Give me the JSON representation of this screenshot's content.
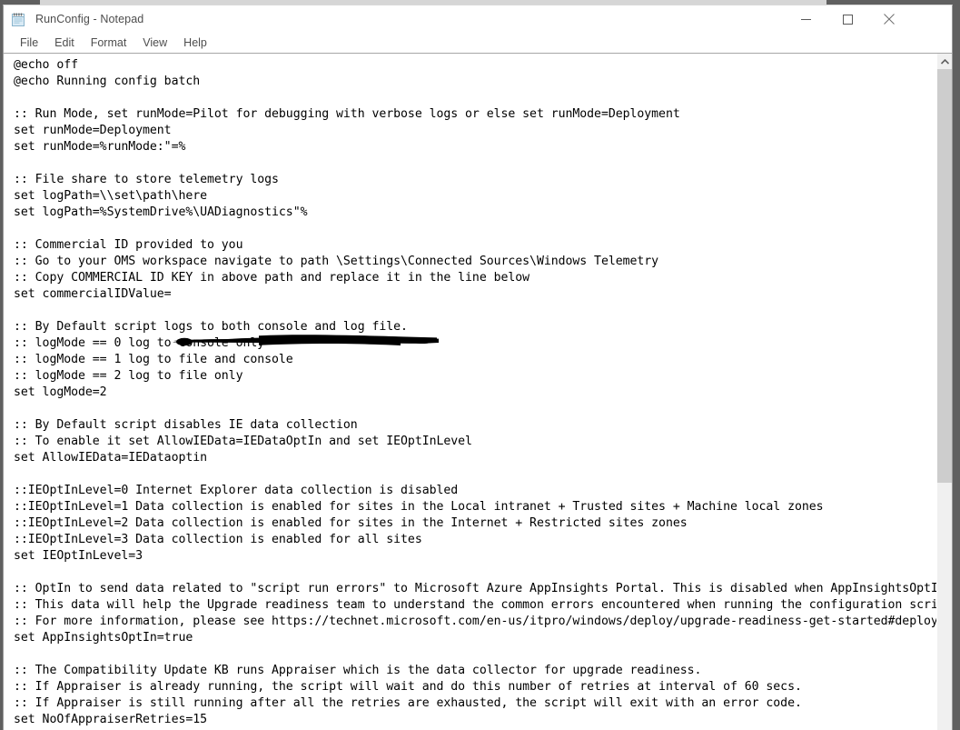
{
  "window": {
    "title": "RunConfig - Notepad",
    "icon": "notepad-icon",
    "controls": {
      "minimize": "minimize-icon",
      "maximize": "maximize-icon",
      "close": "close-icon"
    }
  },
  "menubar": {
    "items": [
      {
        "label": "File"
      },
      {
        "label": "Edit"
      },
      {
        "label": "Format"
      },
      {
        "label": "View"
      },
      {
        "label": "Help"
      }
    ]
  },
  "editor": {
    "content": "@echo off\n@echo Running config batch\n\n:: Run Mode, set runMode=Pilot for debugging with verbose logs or else set runMode=Deployment\nset runMode=Deployment\nset runMode=%runMode:\"=%\n\n:: File share to store telemetry logs\nset logPath=\\\\set\\path\\here\nset logPath=%SystemDrive%\\UADiagnostics\"%\n\n:: Commercial ID provided to you\n:: Go to your OMS workspace navigate to path \\Settings\\Connected Sources\\Windows Telemetry\n:: Copy COMMERCIAL ID KEY in above path and replace it in the line below\nset commercialIDValue=\n\n:: By Default script logs to both console and log file.\n:: logMode == 0 log to console only\n:: logMode == 1 log to file and console\n:: logMode == 2 log to file only\nset logMode=2\n\n:: By Default script disables IE data collection\n:: To enable it set AllowIEData=IEDataOptIn and set IEOptInLevel\nset AllowIEData=IEDataoptin\n\n::IEOptInLevel=0 Internet Explorer data collection is disabled\n::IEOptInLevel=1 Data collection is enabled for sites in the Local intranet + Trusted sites + Machine local zones\n::IEOptInLevel=2 Data collection is enabled for sites in the Internet + Restricted sites zones\n::IEOptInLevel=3 Data collection is enabled for all sites\nset IEOptInLevel=3\n\n:: OptIn to send data related to \"script run errors\" to Microsoft Azure AppInsights Portal. This is disabled when AppInsightsOptIn=false\n:: This data will help the Upgrade readiness team to understand the common errors encountered when running the configuration script\n:: For more information, please see https://technet.microsoft.com/en-us/itpro/windows/deploy/upgrade-readiness-get-started#deployment\nset AppInsightsOptIn=true\n\n:: The Compatibility Update KB runs Appraiser which is the data collector for upgrade readiness.\n:: If Appraiser is already running, the script will wait and do this number of retries at interval of 60 secs.\n:: If Appraiser is still running after all the retries are exhausted, the script will exit with an error code.\nset NoOfAppraiserRetries=15",
    "redaction": "black-marker-redaction-over-commercial-id-value"
  },
  "scrollbar": {
    "up_arrow": "chevron-up-icon"
  }
}
